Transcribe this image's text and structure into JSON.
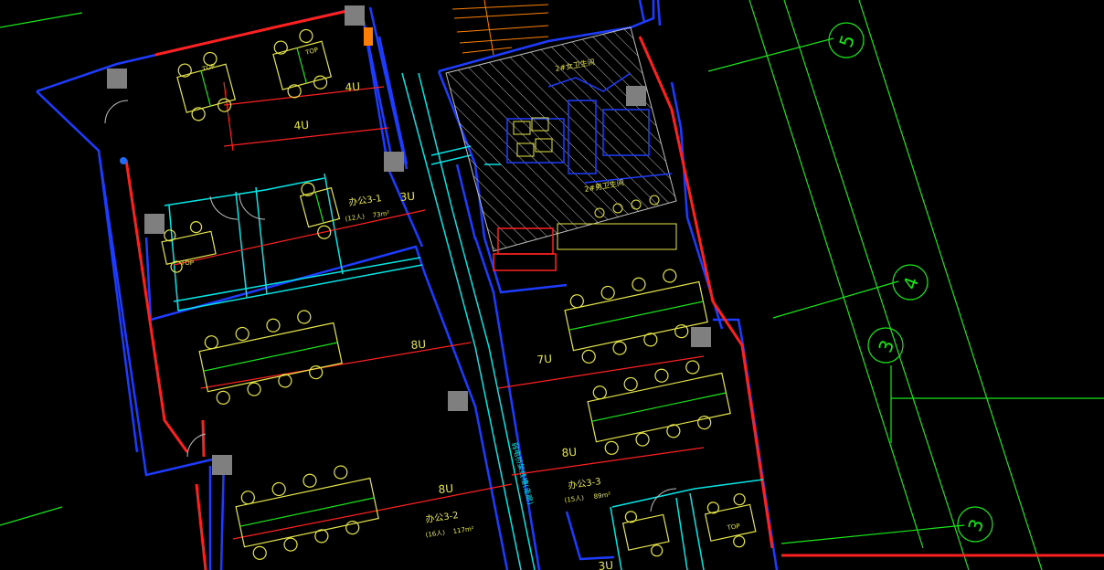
{
  "colors": {
    "background": "#000000",
    "wall": "#1e3cff",
    "partition": "#00e5e5",
    "cable": "#ff2020",
    "furniture": "#e6e64a",
    "grid": "#19e619",
    "column": "#7f7f7f",
    "text": "#e6e64a",
    "hatch": "#bfbfbf",
    "accent": "#ff8000"
  },
  "labels": {
    "u4_a": "4U",
    "u4_b": "4U",
    "u3_top": "3U",
    "u8_mid": "8U",
    "u7": "7U",
    "u8_right": "8U",
    "u8_bottom": "8U",
    "u3_bottom": "3U",
    "room_a1": "办公3-1",
    "room_a1_info_people": "(12人)",
    "room_a1_info_area": "73m²",
    "room_a2": "办公3-2",
    "room_a2_info_people": "(16人)",
    "room_a2_info_area": "117m²",
    "room_a3": "办公3-3",
    "room_a3_info_people": "(15人)",
    "room_a3_info_area": "89m²",
    "wc_female": "2#女卫生间",
    "wc_male": "2#男卫生间",
    "corridor": "弱电桥架线槽(走廊)",
    "top_a": "TOP",
    "top_b": "TOP",
    "top_c": "TOP",
    "top_d": "TOP"
  },
  "grid_axes": [
    "5",
    "4",
    "3",
    "3"
  ]
}
